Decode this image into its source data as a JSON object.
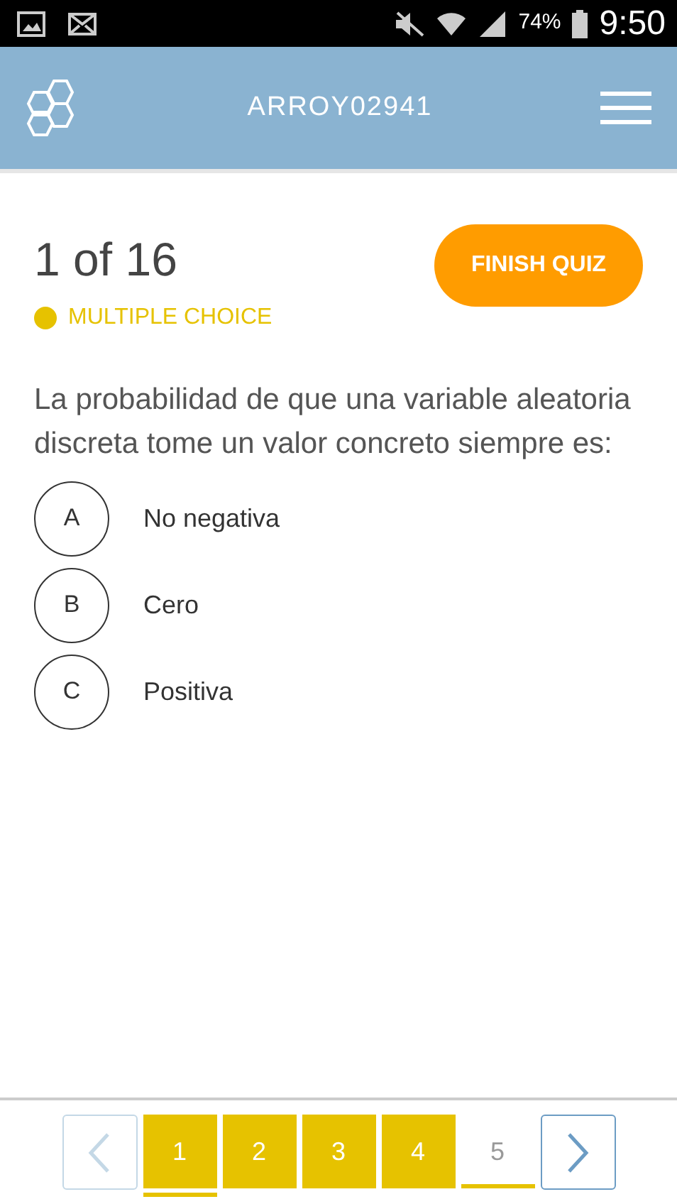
{
  "status_bar": {
    "battery": "74%",
    "time": "9:50"
  },
  "header": {
    "title": "ARROY02941"
  },
  "quiz": {
    "progress": "1 of 16",
    "type": "MULTIPLE CHOICE",
    "finish_button": "FINISH QUIZ"
  },
  "question": "La probabilidad de que una variable aleatoria discreta tome un valor concreto siempre es:",
  "options": [
    {
      "letter": "A",
      "text": "No negativa",
      "selected": false
    },
    {
      "letter": "B",
      "text": "Cero",
      "selected": false
    },
    {
      "letter": "C",
      "text": "Positiva",
      "selected": false
    }
  ],
  "pagination": {
    "prev_disabled": true,
    "next_disabled": false,
    "pages": [
      {
        "label": "1",
        "answered": true,
        "selected": true
      },
      {
        "label": "2",
        "answered": true,
        "selected": false
      },
      {
        "label": "3",
        "answered": true,
        "selected": false
      },
      {
        "label": "4",
        "answered": true,
        "selected": false
      },
      {
        "label": "5",
        "answered": false,
        "selected": false
      }
    ]
  }
}
